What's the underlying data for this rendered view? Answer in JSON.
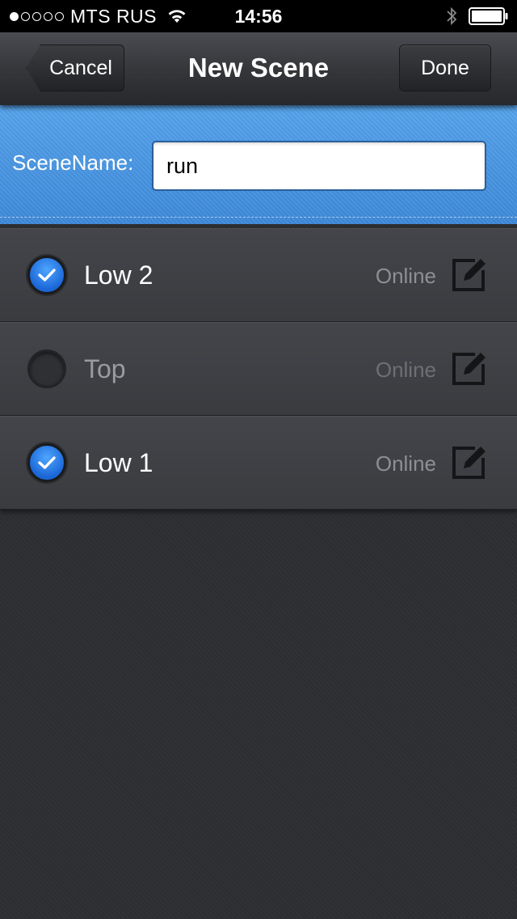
{
  "status_bar": {
    "carrier": "MTS RUS",
    "time": "14:56",
    "signal_bars_filled": 1,
    "signal_bars_total": 5,
    "icons": [
      "wifi-icon",
      "bluetooth-icon",
      "battery-icon"
    ]
  },
  "nav": {
    "title": "New Scene",
    "cancel_label": "Cancel",
    "done_label": "Done"
  },
  "scene_form": {
    "label": "SceneName:",
    "value": "run"
  },
  "devices": [
    {
      "name": "Low 2",
      "status": "Online",
      "selected": true
    },
    {
      "name": "Top",
      "status": "Online",
      "selected": false
    },
    {
      "name": "Low 1",
      "status": "Online",
      "selected": true
    }
  ],
  "colors": {
    "accent_blue": "#4a96e3",
    "background": "#2d2e32",
    "check_blue": "#1b66d6"
  }
}
